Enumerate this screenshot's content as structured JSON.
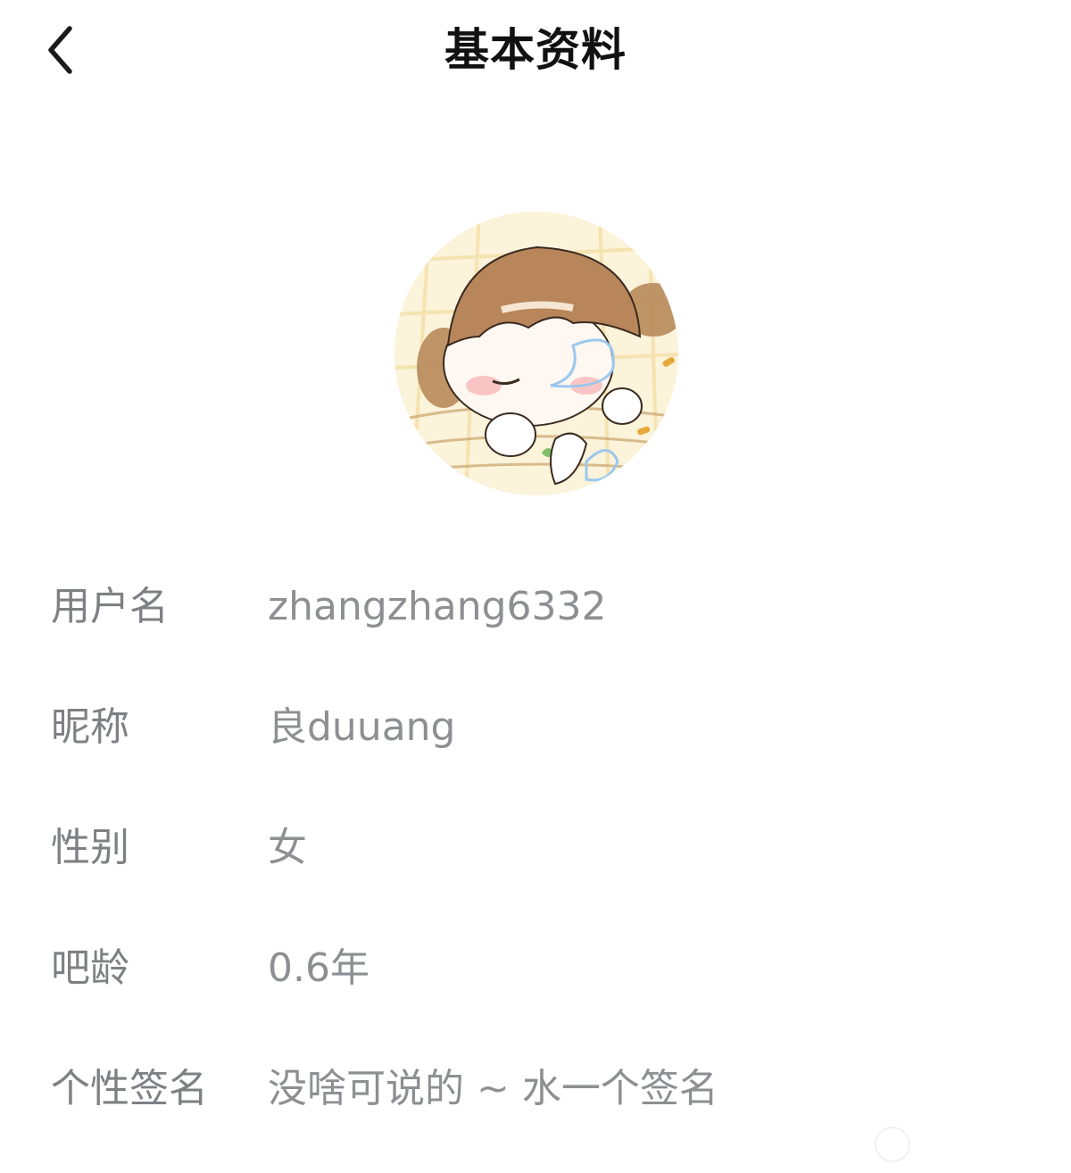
{
  "header": {
    "title": "基本资料",
    "back_icon": "chevron-left-icon"
  },
  "avatar": {
    "description_icon": "avatar-illustration"
  },
  "profile": {
    "rows": [
      {
        "label": "用户名",
        "value": "zhangzhang6332"
      },
      {
        "label": "昵称",
        "value": "良duuang"
      },
      {
        "label": "性别",
        "value": "女"
      },
      {
        "label": "吧龄",
        "value": "0.6年"
      },
      {
        "label": "个性签名",
        "value": "没啥可说的 ~ 水一个签名"
      }
    ]
  },
  "colors": {
    "label": "#7f8084",
    "value": "#8e8f93",
    "title": "#111111",
    "background": "#ffffff"
  }
}
